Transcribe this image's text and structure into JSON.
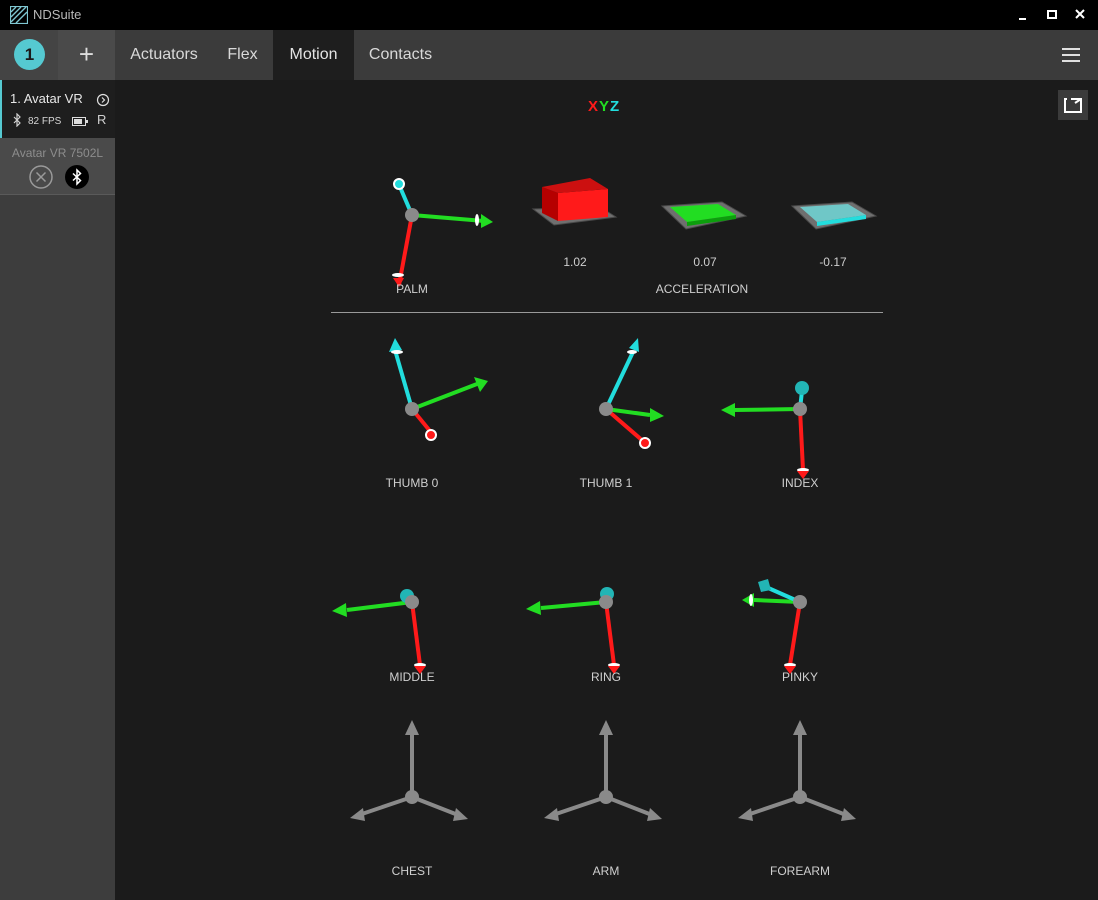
{
  "window": {
    "title": "NDSuite"
  },
  "tabbar": {
    "device_number": "1",
    "add_label": "+",
    "tabs": [
      {
        "label": "Actuators"
      },
      {
        "label": "Flex"
      },
      {
        "label": "Motion"
      },
      {
        "label": "Contacts"
      }
    ],
    "active_tab": "Motion"
  },
  "sidebar": {
    "device": {
      "name": "1. Avatar VR",
      "fps": "82 FPS",
      "hand": "R"
    },
    "device2": {
      "name": "Avatar VR 7502L"
    }
  },
  "motion": {
    "axis_legend": {
      "x": "X",
      "y": "Y",
      "z": "Z"
    },
    "sensors": {
      "palm": "PALM",
      "acceleration": "ACCELERATION",
      "thumb0": "THUMB 0",
      "thumb1": "THUMB 1",
      "index": "INDEX",
      "middle": "MIDDLE",
      "ring": "RING",
      "pinky": "PINKY",
      "chest": "CHEST",
      "arm": "ARM",
      "forearm": "FOREARM"
    },
    "acceleration_values": {
      "x": "1.02",
      "y": "0.07",
      "z": "-0.17"
    }
  },
  "colors": {
    "accent": "#55c9d1",
    "x_axis": "#ff1a1a",
    "y_axis": "#22dd22",
    "z_axis": "#22dddd",
    "inactive_axis": "#8a8a8a"
  }
}
